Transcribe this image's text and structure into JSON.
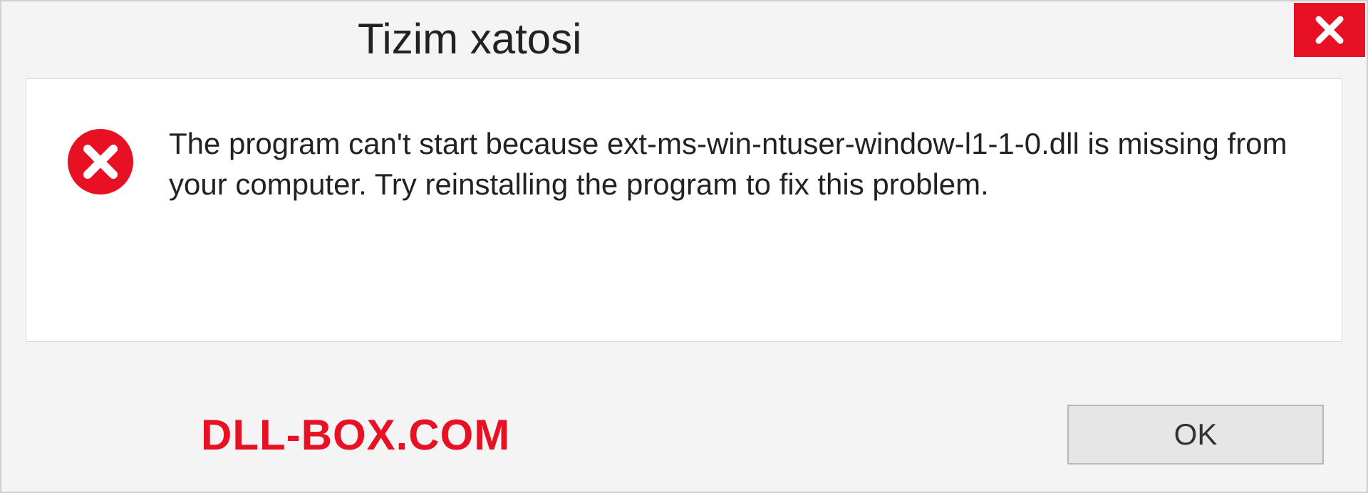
{
  "dialog": {
    "title": "Tizim xatosi",
    "message": "The program can't start because ext-ms-win-ntuser-window-l1-1-0.dll is missing from your computer. Try reinstalling the program to fix this problem.",
    "ok_label": "OK",
    "watermark": "DLL-BOX.COM"
  }
}
